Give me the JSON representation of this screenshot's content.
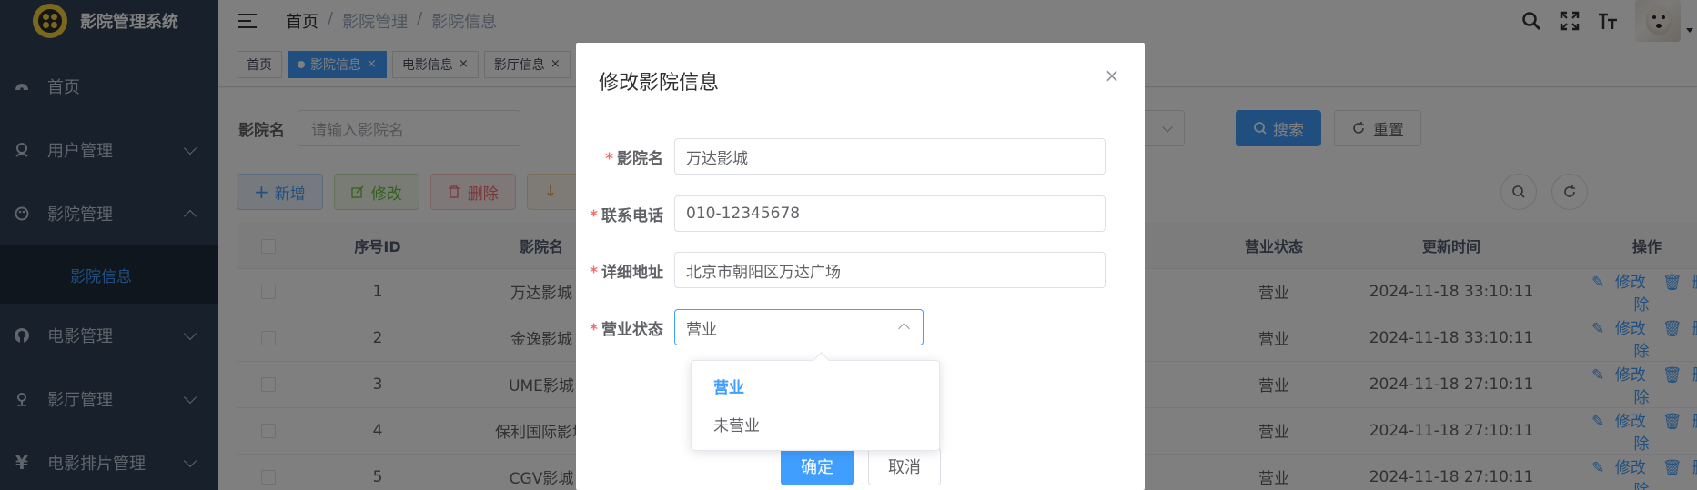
{
  "sidebar": {
    "title": "影院管理系统",
    "items": [
      {
        "label": "首页",
        "icon": "dashboard-icon"
      },
      {
        "label": "用户管理",
        "icon": "user-icon"
      },
      {
        "label": "影院管理",
        "icon": "palette-icon"
      },
      {
        "label": "电影管理",
        "icon": "github-icon"
      },
      {
        "label": "影厅管理",
        "icon": "location-icon"
      },
      {
        "label": "电影排片管理",
        "icon": "yen-icon"
      }
    ],
    "active_sub": "影院信息",
    "yen_glyph": "¥"
  },
  "header": {
    "breadcrumb": [
      "首页",
      "影院管理",
      "影院信息"
    ],
    "breadcrumb_sep": "/",
    "icons": [
      "search-icon",
      "fullscreen-icon",
      "font-size-icon"
    ]
  },
  "tags": [
    {
      "label": "首页",
      "active": false,
      "closable": false
    },
    {
      "label": "影院信息",
      "active": true,
      "closable": true
    },
    {
      "label": "电影信息",
      "active": false,
      "closable": true
    },
    {
      "label": "影厅信息",
      "active": false,
      "closable": true
    }
  ],
  "close_glyph": "×",
  "search": {
    "label": "影院名",
    "placeholder": "请输入影院名",
    "search_button": "搜索",
    "reset_button": "重置"
  },
  "toolbar": {
    "add": "新增",
    "edit": "修改",
    "delete": "删除"
  },
  "table": {
    "columns": [
      "序号ID",
      "影院名",
      "营业状态",
      "更新时间",
      "操作"
    ],
    "rows": [
      {
        "id": "1",
        "name": "万达影城",
        "status": "营业",
        "updated": "2024-11-18 33:10:11"
      },
      {
        "id": "2",
        "name": "金逸影城",
        "status": "营业",
        "updated": "2024-11-18 33:10:11"
      },
      {
        "id": "3",
        "name": "UME影城",
        "status": "营业",
        "updated": "2024-11-18 27:10:11"
      },
      {
        "id": "4",
        "name": "保利国际影城",
        "status": "营业",
        "updated": "2024-11-18 27:10:11"
      },
      {
        "id": "5",
        "name": "CGV影城",
        "status": "营业",
        "updated": "2024-11-18 27:10:11"
      }
    ],
    "op_edit": "修改",
    "op_delete": "删除"
  },
  "dialog": {
    "title": "修改影院信息",
    "required_mark": "*",
    "fields": {
      "name_label": "影院名",
      "name_value": "万达影城",
      "phone_label": "联系电话",
      "phone_value": "010-12345678",
      "address_label": "详细地址",
      "address_value": "北京市朝阳区万达广场",
      "status_label": "营业状态",
      "status_value": "营业"
    },
    "status_options": [
      "营业",
      "未营业"
    ],
    "confirm": "确定",
    "cancel": "取消"
  },
  "colors": {
    "primary": "#409eff",
    "sidebar_bg": "#304156",
    "danger": "#f56c6c"
  }
}
